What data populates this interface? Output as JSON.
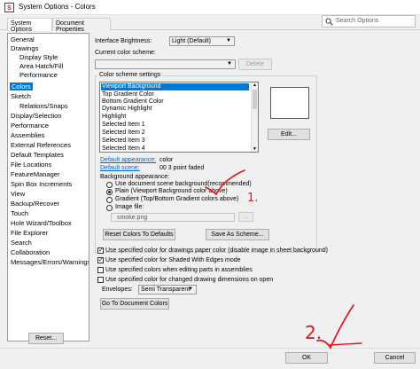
{
  "window": {
    "title": "System Options - Colors"
  },
  "tabs": [
    {
      "label": "System Options",
      "active": true
    },
    {
      "label": "Document Properties",
      "active": false
    }
  ],
  "search": {
    "placeholder": "Search Options"
  },
  "categories": [
    {
      "label": "General",
      "level": 1
    },
    {
      "label": "Drawings",
      "level": 1
    },
    {
      "label": "Display Style",
      "level": 2
    },
    {
      "label": "Area Hatch/Fill",
      "level": 2
    },
    {
      "label": "Performance",
      "level": 2
    },
    {
      "label": "Colors",
      "level": 1,
      "selected": true
    },
    {
      "label": "Sketch",
      "level": 1
    },
    {
      "label": "Relations/Snaps",
      "level": 2
    },
    {
      "label": "Display/Selection",
      "level": 1
    },
    {
      "label": "Performance",
      "level": 1
    },
    {
      "label": "Assemblies",
      "level": 1
    },
    {
      "label": "External References",
      "level": 1
    },
    {
      "label": "Default Templates",
      "level": 1
    },
    {
      "label": "File Locations",
      "level": 1
    },
    {
      "label": "FeatureManager",
      "level": 1
    },
    {
      "label": "Spin Box Increments",
      "level": 1
    },
    {
      "label": "View",
      "level": 1
    },
    {
      "label": "Backup/Recover",
      "level": 1
    },
    {
      "label": "Touch",
      "level": 1
    },
    {
      "label": "Hole Wizard/Toolbox",
      "level": 1
    },
    {
      "label": "File Explorer",
      "level": 1
    },
    {
      "label": "Search",
      "level": 1
    },
    {
      "label": "Collaboration",
      "level": 1
    },
    {
      "label": "Messages/Errors/Warnings",
      "level": 1
    }
  ],
  "reset_label": "Reset...",
  "brightness": {
    "label": "Interface Brightness:",
    "value": "Light (Default)"
  },
  "scheme": {
    "label": "Current color scheme:",
    "value": "",
    "delete_label": "Delete"
  },
  "color_scheme": {
    "title": "Color scheme settings",
    "items": [
      {
        "label": "Viewport Background",
        "selected": true
      },
      {
        "label": "Top Gradient Color"
      },
      {
        "label": "Bottom Gradient Color"
      },
      {
        "label": "Dynamic Highlight"
      },
      {
        "label": "Highlight"
      },
      {
        "label": "Selected Item 1"
      },
      {
        "label": "Selected Item 2"
      },
      {
        "label": "Selected Item 3"
      },
      {
        "label": "Selected Item 4"
      }
    ],
    "edit_label": "Edit..."
  },
  "defaults": {
    "appearance_label": "Default appearance:",
    "appearance_value": "color",
    "scene_label": "Default scene:",
    "scene_value": "00 3 point faded"
  },
  "background": {
    "title": "Background appearance:",
    "options": [
      {
        "label": "Use document scene background(recommended)",
        "checked": false
      },
      {
        "label": "Plain (Viewport Background color above)",
        "checked": true
      },
      {
        "label": "Gradient (Top/Bottom Gradient colors above)",
        "checked": false
      },
      {
        "label": "Image file:",
        "checked": false
      }
    ],
    "image_file": "smoke.png",
    "browse_label": "..."
  },
  "reset_colors_label": "Reset Colors To Defaults",
  "save_scheme_label": "Save As Scheme...",
  "checkboxes": [
    {
      "label": "Use specified color for drawings paper color (disable image in sheet background)",
      "checked": true
    },
    {
      "label": "Use specified color for Shaded With Edges mode",
      "checked": true
    },
    {
      "label": "Use specified colors when editing parts in assemblies",
      "checked": false
    },
    {
      "label": "Use specified color for changed drawing dimensions on open",
      "checked": false
    }
  ],
  "envelopes": {
    "label": "Envelopes:",
    "value": "Semi Transparent"
  },
  "goto_label": "Go To Document Colors",
  "ok_label": "OK",
  "cancel_label": "Cancel",
  "annotations": [
    "1.",
    "2."
  ],
  "colors": {
    "selection": "#0078d7",
    "annotation": "#e0141e",
    "link": "#0066cc"
  }
}
